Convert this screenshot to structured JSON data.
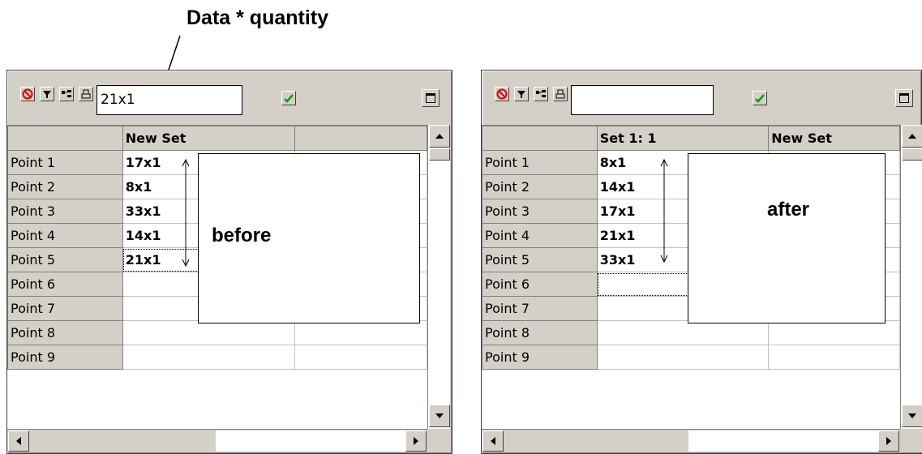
{
  "callout": "Data * quantity",
  "before": {
    "entry_value": "21x1",
    "headers": [
      "",
      "New Set",
      ""
    ],
    "rows": [
      {
        "label": "Point 1",
        "value": "17x1"
      },
      {
        "label": "Point 2",
        "value": "8x1"
      },
      {
        "label": "Point 3",
        "value": "33x1"
      },
      {
        "label": "Point 4",
        "value": "14x1"
      },
      {
        "label": "Point 5",
        "value": "21x1"
      },
      {
        "label": "Point 6",
        "value": ""
      },
      {
        "label": "Point 7",
        "value": ""
      },
      {
        "label": "Point 8",
        "value": ""
      },
      {
        "label": "Point 9",
        "value": ""
      }
    ],
    "note": "before"
  },
  "after": {
    "entry_value": "",
    "headers": [
      "",
      "Set 1: 1",
      "New Set"
    ],
    "rows": [
      {
        "label": "Point 1",
        "value": "8x1"
      },
      {
        "label": "Point 2",
        "value": "14x1"
      },
      {
        "label": "Point 3",
        "value": "17x1"
      },
      {
        "label": "Point 4",
        "value": "21x1"
      },
      {
        "label": "Point 5",
        "value": "33x1"
      },
      {
        "label": "Point 6",
        "value": ""
      },
      {
        "label": "Point 7",
        "value": ""
      },
      {
        "label": "Point 8",
        "value": ""
      },
      {
        "label": "Point 9",
        "value": ""
      }
    ],
    "note": "after"
  },
  "toolbar_icons": [
    "stop-icon",
    "filter-icon",
    "sort-icon",
    "print-icon"
  ],
  "colors": {
    "window_face": "#d4d0c8",
    "check_green": "#00a000",
    "stop_red": "#e00000"
  }
}
